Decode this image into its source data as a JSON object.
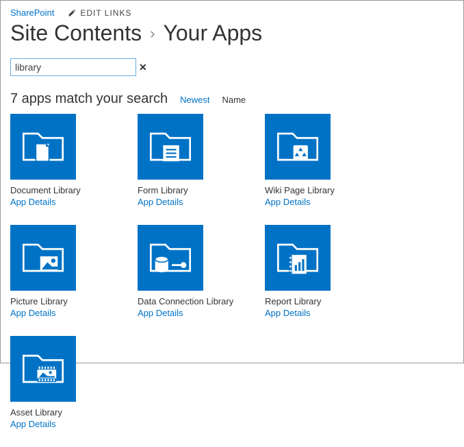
{
  "top_nav": {
    "sharepoint": "SharePoint",
    "edit_links": "EDIT LINKS"
  },
  "breadcrumb": {
    "root": "Site Contents",
    "current": "Your Apps"
  },
  "search": {
    "value": "library"
  },
  "results": {
    "count_text": "7 apps match your search",
    "sort_newest": "Newest",
    "sort_name": "Name"
  },
  "apps": [
    {
      "name": "Document Library",
      "details": "App Details",
      "icon": "document"
    },
    {
      "name": "Form Library",
      "details": "App Details",
      "icon": "form"
    },
    {
      "name": "Wiki Page Library",
      "details": "App Details",
      "icon": "wiki"
    },
    {
      "name": "Picture Library",
      "details": "App Details",
      "icon": "picture"
    },
    {
      "name": "Data Connection Library",
      "details": "App Details",
      "icon": "dataconn"
    },
    {
      "name": "Report Library",
      "details": "App Details",
      "icon": "report"
    },
    {
      "name": "Asset Library",
      "details": "App Details",
      "icon": "asset"
    }
  ]
}
